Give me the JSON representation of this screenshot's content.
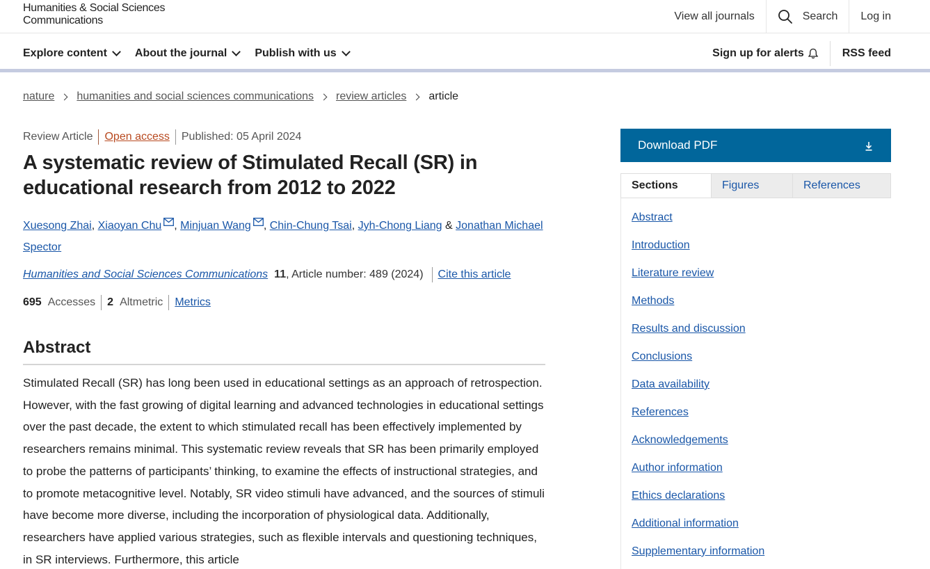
{
  "header": {
    "logo_line1": "Humanities & Social Sciences",
    "logo_line2": "Communications",
    "view_all": "View all journals",
    "search": "Search",
    "login": "Log in"
  },
  "nav": {
    "explore": "Explore content",
    "about": "About the journal",
    "publish": "Publish with us",
    "alerts": "Sign up for alerts",
    "rss": "RSS feed"
  },
  "breadcrumb": [
    "nature",
    "humanities and social sciences communications",
    "review articles",
    "article"
  ],
  "article": {
    "type": "Review Article",
    "access": "Open access",
    "published": "Published: 05 April 2024",
    "title": "A systematic review of Stimulated Recall (SR) in educational research from 2012 to 2022",
    "authors": [
      "Xuesong Zhai",
      "Xiaoyan Chu",
      "Minjuan Wang",
      "Chin-Chung Tsai",
      "Jyh-Chong Liang",
      "Jonathan Michael Spector"
    ],
    "journal": "Humanities and Social Sciences Communications",
    "volume": "11",
    "article_number": ", Article number: 489 (2024)",
    "cite": "Cite this article",
    "accesses_num": "695",
    "accesses_label": "Accesses",
    "altmetric_num": "2",
    "altmetric_label": "Altmetric",
    "metrics": "Metrics"
  },
  "abstract": {
    "heading": "Abstract",
    "text": "Stimulated Recall (SR) has long been used in educational settings as an approach of retrospection. However, with the fast growing of digital learning and advanced technologies in educational settings over the past decade, the extent to which stimulated recall has been effectively implemented by researchers remains minimal. This systematic review reveals that SR has been primarily employed to probe the patterns of participants’ thinking, to examine the effects of instructional strategies, and to promote metacognitive level. Notably, SR video stimuli have advanced, and the sources of stimuli have become more diverse, including the incorporation of physiological data. Additionally, researchers have applied various strategies, such as flexible intervals and questioning techniques, in SR interviews. Furthermore, this article"
  },
  "sidebar": {
    "download": "Download PDF",
    "tabs": [
      "Sections",
      "Figures",
      "References"
    ],
    "sections": [
      "Abstract",
      "Introduction",
      "Literature review",
      "Methods",
      "Results and discussion",
      "Conclusions",
      "Data availability",
      "References",
      "Acknowledgements",
      "Author information",
      "Ethics declarations",
      "Additional information",
      "Supplementary information"
    ]
  },
  "colors": {
    "link": "#1a57a8",
    "download_bg": "#01669b",
    "open_access": "#b8491f",
    "nav_underline": "#c5cbe0"
  }
}
